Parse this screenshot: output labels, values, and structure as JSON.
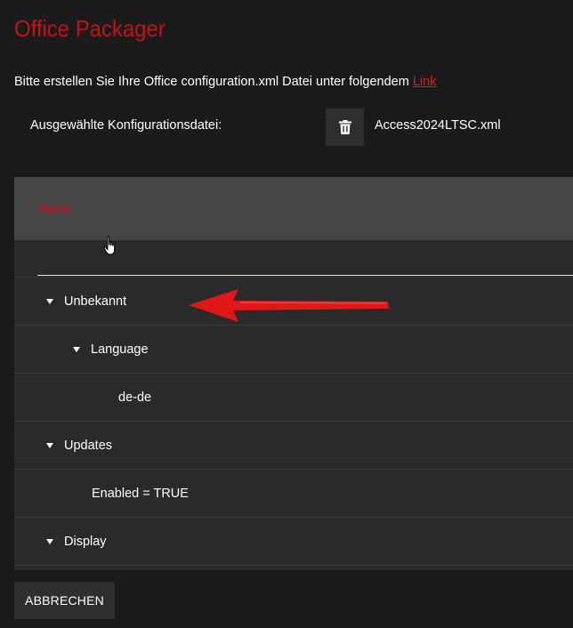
{
  "header": {
    "title": "Office Packager"
  },
  "intro": {
    "text": "Bitte erstellen Sie Ihre Office configuration.xml Datei unter folgendem ",
    "link_label": "Link"
  },
  "config": {
    "label": "Ausgewählte Konfigurationsdatei:",
    "delete_icon": "trash-icon",
    "file_name": "Access2024LTSC.xml"
  },
  "tree": {
    "column_header": "Name",
    "filter_value": "",
    "rows": [
      {
        "label": "Unbekannt",
        "expandable": true
      },
      {
        "label": "Language",
        "expandable": true
      },
      {
        "label": "de-de",
        "expandable": false
      },
      {
        "label": "Updates",
        "expandable": true
      },
      {
        "label": "Enabled = TRUE",
        "expandable": false
      },
      {
        "label": "Display",
        "expandable": true
      }
    ]
  },
  "footer": {
    "cancel_label": "ABBRECHEN"
  },
  "colors": {
    "accent": "#c4121c",
    "background": "#1b1b1b",
    "panel": "#2a2a2a",
    "header": "#464646",
    "annotation_arrow": "#e01818"
  }
}
